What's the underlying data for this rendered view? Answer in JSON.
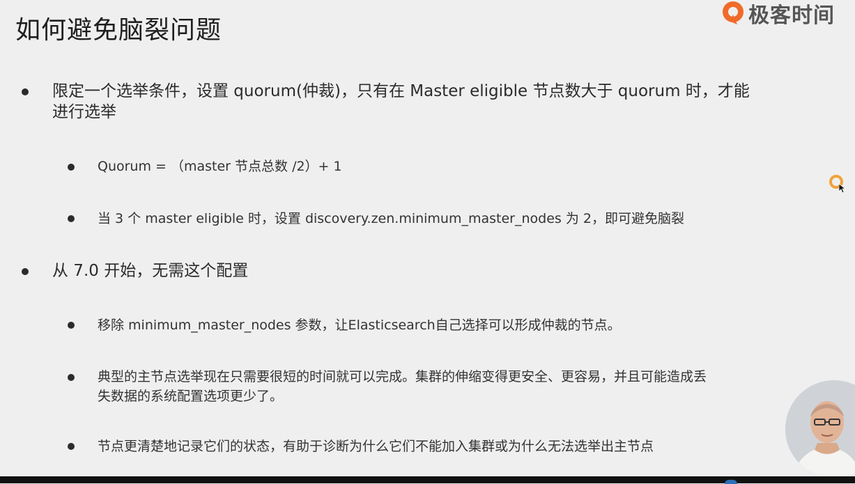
{
  "slide": {
    "title": "如何避免脑裂问题"
  },
  "logo": {
    "text": "极客时间",
    "accent_color": "#f06b2a"
  },
  "bullets": [
    {
      "level": 1,
      "line1": "限定一个选举条件，设置 quorum(仲裁)，只有在 Master eligible 节点数大于 quorum 时，才能",
      "line2": "进行选举"
    },
    {
      "level": 2,
      "line1": "Quorum = （master 节点总数 /2）+ 1"
    },
    {
      "level": 2,
      "line1": "当 3 个 master eligible 时，设置 discovery.zen.minimum_master_nodes 为 2，即可避免脑裂"
    },
    {
      "level": 1,
      "line1": "从 7.0 开始，无需这个配置"
    },
    {
      "level": 2,
      "line1": "移除 minimum_master_nodes 参数，让Elasticsearch自己选择可以形成仲裁的节点。"
    },
    {
      "level": 2,
      "line1": "典型的主节点选举现在只需要很短的时间就可以完成。集群的伸缩变得更安全、更容易，并且可能造成丢",
      "line2": "失数据的系统配置选项更少了。"
    },
    {
      "level": 2,
      "line1": "节点更清楚地记录它们的状态，有助于诊断为什么它们不能加入集群或为什么无法选举出主节点"
    }
  ],
  "icons": {
    "logo": "geektime-logo-icon",
    "cursor": "cursor-arrow-icon",
    "bullet": "bullet-dot-icon"
  }
}
